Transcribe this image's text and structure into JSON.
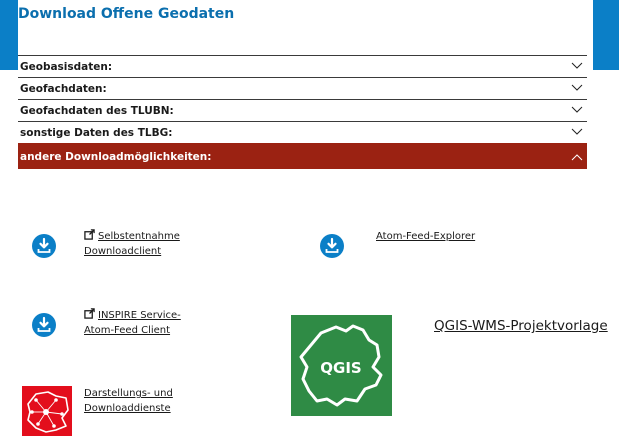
{
  "page": {
    "title": "Download Offene Geodaten"
  },
  "colors": {
    "accent_blue": "#0b7fc7",
    "title_blue": "#0b6fae",
    "open_section_red": "#9b2212",
    "qgis_green": "#2f8b45",
    "map_red": "#e30e1c"
  },
  "accordion": {
    "sections": [
      {
        "label": "Geobasisdaten:",
        "expanded": false
      },
      {
        "label": "Geofachdaten:",
        "expanded": false
      },
      {
        "label": "Geofachdaten des TLUBN:",
        "expanded": false
      },
      {
        "label": "sonstige Daten des TLBG:",
        "expanded": false
      },
      {
        "label": "andere Downloadmöglichkeiten:",
        "expanded": true
      }
    ]
  },
  "downloads": {
    "selbstentnahme": {
      "line1": "Selbstentnahme",
      "line2": "Downloadclient",
      "icon": "download-circle-icon",
      "external": true
    },
    "atom_explorer": {
      "line1": "Atom-Feed-Explorer",
      "icon": "download-circle-icon",
      "external": false
    },
    "inspire": {
      "line1": "INSPIRE Service-",
      "line2": "Atom-Feed Client",
      "icon": "download-circle-icon",
      "external": true
    },
    "qgis": {
      "label": "QGIS-WMS-Projektvorlage",
      "logo_text": "QGIS",
      "icon": "qgis-logo-icon"
    },
    "darstellung": {
      "line1": "Darstellungs- und",
      "line2": "Downloaddienste",
      "icon": "network-map-icon"
    }
  }
}
